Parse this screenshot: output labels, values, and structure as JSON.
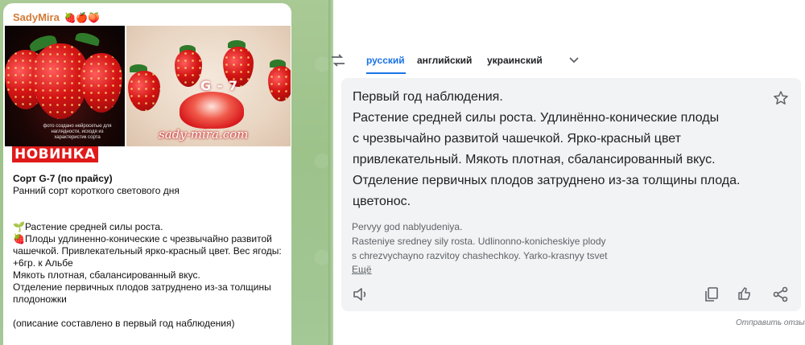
{
  "chat": {
    "sender_name": "SadyMira",
    "sender_emoji": "🍓🍎🍑",
    "photo_left_caption": "фото создано нейросетью для наглядности, исходя из характеристик сорта",
    "photo_right_label": "G - 7",
    "photo_right_url": "sady-mira.com",
    "badge": "НОВИНКА",
    "title": "Сорт G-7 (по прайсу)",
    "subtitle": "Ранний сорт короткого светового дня",
    "line1": "🌱Растение средней силы роста.",
    "line2": "🍓Плоды удлиненно-конические с чрезвычайно развитой чашечкой. Привлекательный ярко-красный цвет. Вес ягоды: +6гр. к Альбе",
    "line3": "Мякоть плотная, сбалансированный вкус.",
    "line4": "Отделение первичных плодов затруднено из-за толщины плодоножки",
    "line5": "(описание составлено в первый год наблюдения)"
  },
  "translate": {
    "languages": [
      "русский",
      "английский",
      "украинский"
    ],
    "active_language": "русский",
    "result_lines": [
      "Первый год наблюдения.",
      "Растение средней силы роста. Удлинённо-конические плоды",
      "с чрезвычайно развитой чашечкой. Ярко-красный цвет",
      "привлекательный. Мякоть плотная, сбалансированный вкус.",
      "Отделение первичных плодов затруднено из-за толщины плода.",
      "цветонос."
    ],
    "transliteration_lines": [
      "Pervyy god nablyudeniya.",
      "Rasteniye sredney sily rosta. Udlinonno-konicheskiye plody",
      "s chrezvychayno razvitoy chashechkoy. Yarko-krasnyy tsvet"
    ],
    "more_label": "Ещё",
    "feedback_label": "Отправить отзыв",
    "accent_color": "#1a73e8"
  }
}
